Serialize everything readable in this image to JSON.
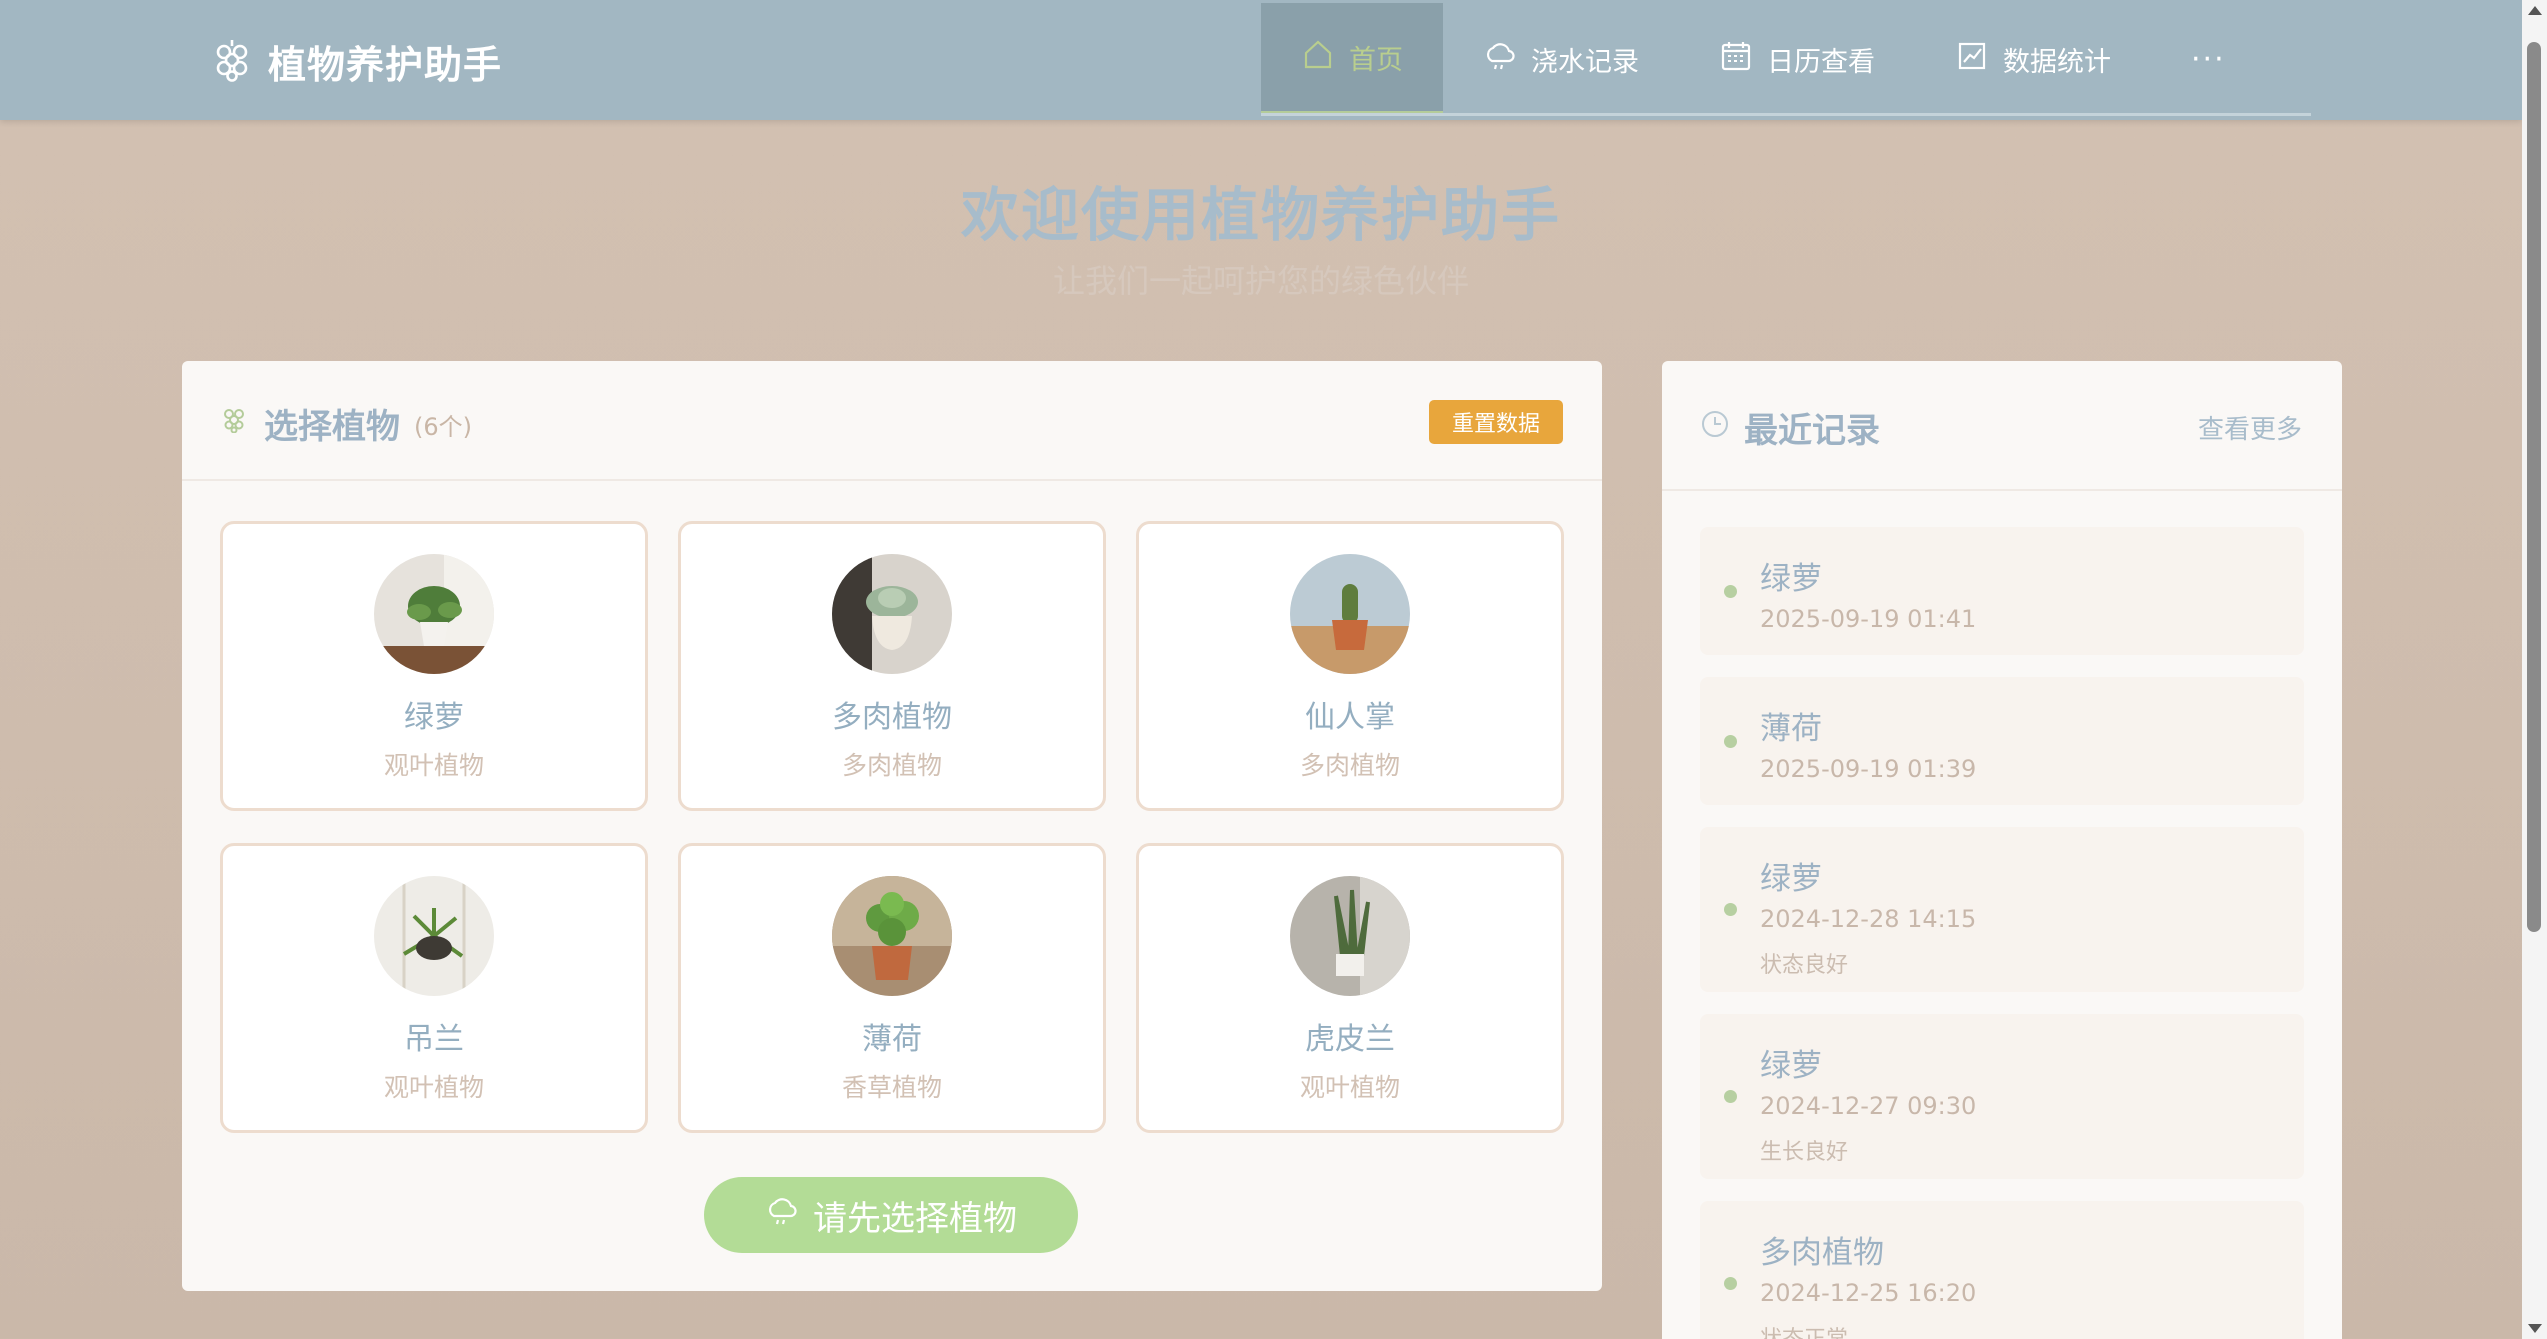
{
  "app": {
    "brand_icon": "grape-icon",
    "title": "植物养护助手"
  },
  "nav": {
    "items": [
      {
        "label": "首页",
        "icon": "home-icon",
        "active": true
      },
      {
        "label": "浇水记录",
        "icon": "rain-cloud-icon"
      },
      {
        "label": "日历查看",
        "icon": "calendar-icon"
      },
      {
        "label": "数据统计",
        "icon": "chart-icon"
      }
    ],
    "more_label": "···"
  },
  "hero": {
    "title": "欢迎使用植物养护助手",
    "subtitle": "让我们一起呵护您的绿色伙伴"
  },
  "plants_panel": {
    "title": "选择植物",
    "count": "(6个)",
    "reset_label": "重置数据",
    "plants": [
      {
        "name": "绿萝",
        "type": "观叶植物"
      },
      {
        "name": "多肉植物",
        "type": "多肉植物"
      },
      {
        "name": "仙人掌",
        "type": "多肉植物"
      },
      {
        "name": "吊兰",
        "type": "观叶植物"
      },
      {
        "name": "薄荷",
        "type": "香草植物"
      },
      {
        "name": "虎皮兰",
        "type": "观叶植物"
      }
    ],
    "water_button": "请先选择植物"
  },
  "recent": {
    "title": "最近记录",
    "more_label": "查看更多",
    "records": [
      {
        "name": "绿萝",
        "date": "2025-09-19 01:41",
        "note": ""
      },
      {
        "name": "薄荷",
        "date": "2025-09-19 01:39",
        "note": ""
      },
      {
        "name": "绿萝",
        "date": "2024-12-28 14:15",
        "note": "状态良好"
      },
      {
        "name": "绿萝",
        "date": "2024-12-27 09:30",
        "note": "生长良好"
      },
      {
        "name": "多肉植物",
        "date": "2024-12-25 16:20",
        "note": "状态正常"
      }
    ]
  },
  "colors": {
    "header": "#a2b7c2",
    "accent_orange": "#e8a63c",
    "accent_green": "#b3dc96",
    "text_blue": "#9db2c4"
  }
}
